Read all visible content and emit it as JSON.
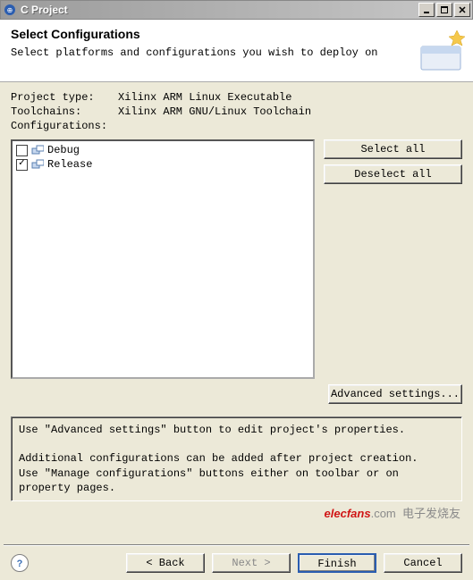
{
  "window": {
    "title": "C Project"
  },
  "header": {
    "title": "Select Configurations",
    "subtitle": "Select platforms and configurations you wish to deploy on"
  },
  "meta": {
    "project_type_label": "Project type:",
    "project_type": "Xilinx ARM Linux Executable",
    "toolchains_label": "Toolchains:",
    "toolchains": "Xilinx ARM GNU/Linux Toolchain",
    "configurations_label": "Configurations:"
  },
  "configs": [
    {
      "name": "Debug",
      "checked": false
    },
    {
      "name": "Release",
      "checked": true
    }
  ],
  "buttons": {
    "select_all": "Select all",
    "deselect_all": "Deselect all",
    "advanced": "Advanced settings..."
  },
  "info": {
    "line1": "Use \"Advanced settings\" button to edit project's properties.",
    "line2": "Additional configurations can be added after project creation.",
    "line3": "Use \"Manage configurations\" buttons either on toolbar or on property pages."
  },
  "footer": {
    "back": "< Back",
    "next": "Next >",
    "finish": "Finish",
    "cancel": "Cancel"
  },
  "watermark": {
    "brand": "elecfans",
    "suffix": ".com",
    "cn": "电子发烧友"
  }
}
